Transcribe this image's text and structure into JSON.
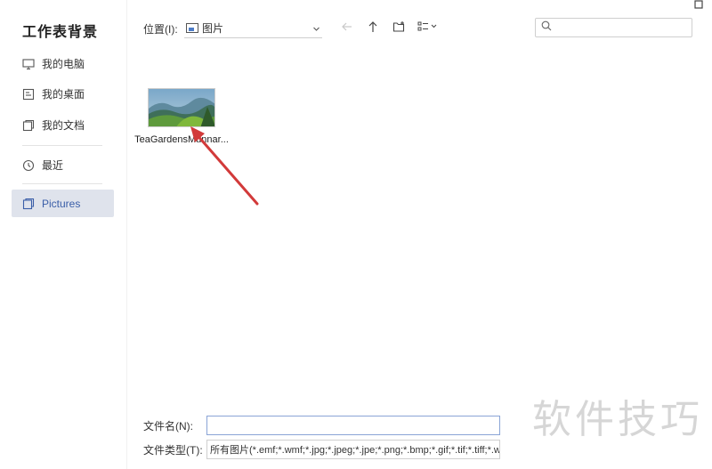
{
  "window": {
    "maximize_icon": "square-icon"
  },
  "sidebar": {
    "title": "工作表背景",
    "items": [
      {
        "label": "我的电脑",
        "icon": "monitor-icon"
      },
      {
        "label": "我的桌面",
        "icon": "desktop-icon"
      },
      {
        "label": "我的文档",
        "icon": "documents-icon"
      },
      {
        "label": "最近",
        "icon": "clock-icon"
      },
      {
        "label": "Pictures",
        "icon": "folder-icon",
        "active": true
      }
    ]
  },
  "toolbar": {
    "location_label": "位置(I):",
    "location_value": "图片",
    "search_placeholder": ""
  },
  "files": [
    {
      "name": "TeaGardensMunnar..."
    }
  ],
  "form": {
    "filename_label": "文件名(N):",
    "filename_value": "",
    "filetype_label": "文件类型(T):",
    "filetype_value": "所有图片(*.emf;*.wmf;*.jpg;*.jpeg;*.jpe;*.png;*.bmp;*.gif;*.tif;*.tiff;*.wd"
  },
  "watermark": "软件技巧",
  "colors": {
    "accent": "#3a5ea8",
    "active_bg": "#dfe3ec",
    "arrow": "#d23a3a"
  }
}
